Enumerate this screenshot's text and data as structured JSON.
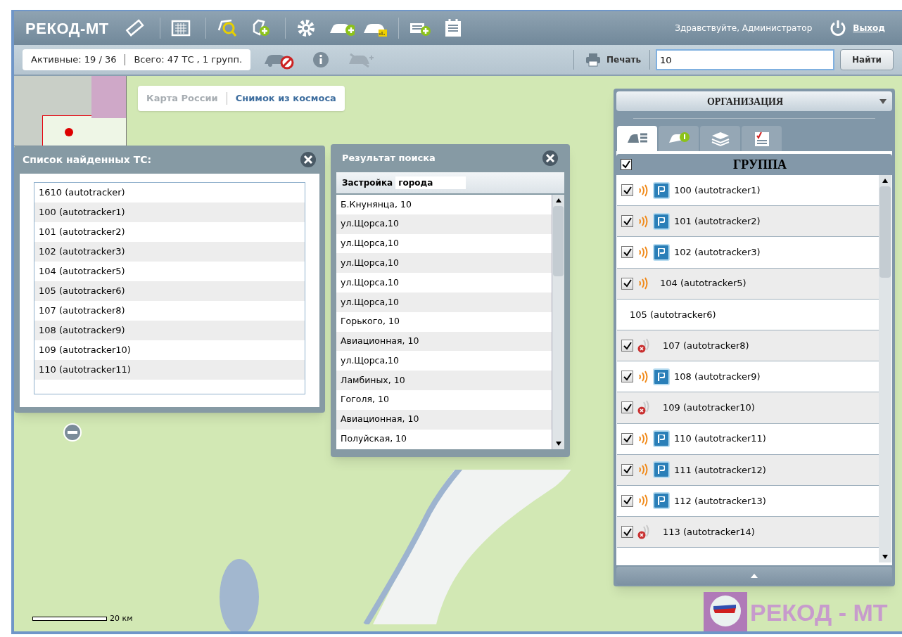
{
  "header": {
    "logo": "РЕКОД-МТ",
    "greeting": "Здравствуйте, Администратор",
    "logout": "Выход"
  },
  "status": {
    "active": "Активные: 19 / 36",
    "total": "Всего: 47 ТС , 1 групп."
  },
  "print": "Печать",
  "search": {
    "value": "10",
    "button": "Найти"
  },
  "map_switch": [
    {
      "label": "Карта России",
      "selected": false
    },
    {
      "label": "Снимок из космоса",
      "selected": true
    }
  ],
  "scale": "20 км",
  "found_panel": {
    "title": "Список найденных ТС:",
    "items": [
      "1610 (autotracker)",
      "100 (autotracker1)",
      "101 (autotracker2)",
      "102 (autotracker3)",
      "104 (autotracker5)",
      "105 (autotracker6)",
      "107 (autotracker8)",
      "108 (autotracker9)",
      "109 (autotracker10)",
      "110 (autotracker11)"
    ]
  },
  "result_panel": {
    "title": "Результат поиска",
    "category": "Застройка",
    "subcategory": "города",
    "items": [
      "Б.Кнунянца, 10",
      "ул.Щорса,10",
      "ул.Щорса,10",
      "ул.Щорса,10",
      "ул.Щорса,10",
      "ул.Щорса,10",
      "Горького, 10",
      "Авиационная, 10",
      "ул.Щорса,10",
      "Ламбиных, 10",
      "Гоголя, 10",
      "Авиационная, 10",
      "Полуйская, 10"
    ]
  },
  "right_panel": {
    "dropdown": "ОРГАНИЗАЦИЯ",
    "tabs": [
      {
        "selected": true
      },
      {
        "selected": false
      },
      {
        "selected": false
      },
      {
        "selected": false
      }
    ],
    "group": {
      "label": "ГРУППА",
      "checked": true
    },
    "rows": [
      {
        "kind": "tracked",
        "label": "100 (autotracker1)",
        "checked": true,
        "signal_lost": false,
        "parked": true
      },
      {
        "kind": "tracked",
        "label": "101 (autotracker2)",
        "checked": true,
        "signal_lost": false,
        "parked": true
      },
      {
        "kind": "tracked",
        "label": "102 (autotracker3)",
        "checked": true,
        "signal_lost": false,
        "parked": true
      },
      {
        "kind": "tracked",
        "label": "104 (autotracker5)",
        "checked": true,
        "signal_lost": false,
        "parked": false
      },
      {
        "kind": "untracked",
        "label": "105 (autotracker6)"
      },
      {
        "kind": "tracked",
        "label": "107 (autotracker8)",
        "checked": true,
        "signal_lost": true,
        "parked": false
      },
      {
        "kind": "tracked",
        "label": "108 (autotracker9)",
        "checked": true,
        "signal_lost": false,
        "parked": true
      },
      {
        "kind": "tracked",
        "label": "109 (autotracker10)",
        "checked": true,
        "signal_lost": true,
        "parked": false
      },
      {
        "kind": "tracked",
        "label": "110 (autotracker11)",
        "checked": true,
        "signal_lost": false,
        "parked": true
      },
      {
        "kind": "tracked",
        "label": "111 (autotracker12)",
        "checked": true,
        "signal_lost": false,
        "parked": true
      },
      {
        "kind": "tracked",
        "label": "112 (autotracker13)",
        "checked": true,
        "signal_lost": false,
        "parked": true
      },
      {
        "kind": "tracked",
        "label": "113 (autotracker14)",
        "checked": true,
        "signal_lost": true,
        "parked": false
      }
    ]
  },
  "brand": {
    "logo": "РЕКОД - МТ"
  }
}
